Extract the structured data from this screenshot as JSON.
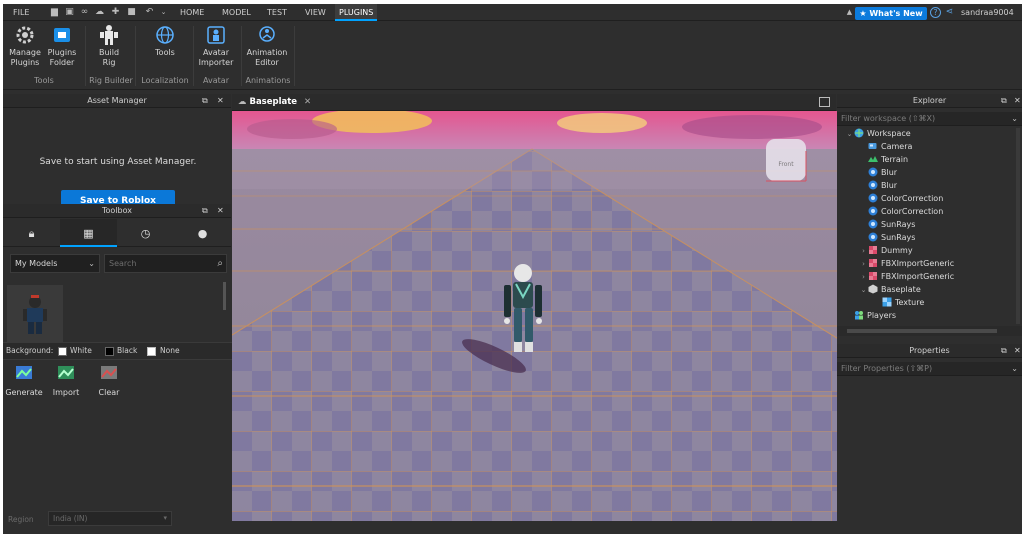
{
  "menubar": {
    "file": "FILE",
    "tabs": [
      "HOME",
      "MODEL",
      "TEST",
      "VIEW",
      "PLUGINS"
    ],
    "active_tab": "PLUGINS",
    "whats_new": "What's New",
    "username": "sandraa9004"
  },
  "ribbon": {
    "buttons": [
      {
        "label1": "Manage",
        "label2": "Plugins",
        "icon": "gear-icon"
      },
      {
        "label1": "Plugins",
        "label2": "Folder",
        "icon": "folder-plug-icon"
      },
      {
        "label1": "Build",
        "label2": "Rig",
        "icon": "rig-icon"
      },
      {
        "label1": "Tools",
        "label2": "",
        "icon": "globe-icon"
      },
      {
        "label1": "Avatar",
        "label2": "Importer",
        "icon": "avatar-importer-icon"
      },
      {
        "label1": "Animation",
        "label2": "Editor",
        "icon": "animation-editor-icon"
      }
    ],
    "groups": [
      "Tools",
      "Rig Builder",
      "Localization",
      "Avatar",
      "Animations"
    ]
  },
  "asset_manager": {
    "title": "Asset Manager",
    "message": "Save to start using Asset Manager.",
    "save_button": "Save to Roblox"
  },
  "toolbox": {
    "title": "Toolbox",
    "tabs": [
      "lock-icon",
      "grid-icon",
      "clock-icon",
      "lightbulb-icon"
    ],
    "category": "My Models",
    "search_placeholder": "Search",
    "background_label": "Background:",
    "bg_options": [
      "White",
      "Black",
      "None"
    ],
    "tools": [
      "Generate",
      "Import",
      "Clear"
    ],
    "region_label": "Region",
    "region_value": "India (IN)"
  },
  "viewport": {
    "tab_label": "Baseplate",
    "view_cube_label": "Front"
  },
  "explorer": {
    "title": "Explorer",
    "filter_placeholder": "Filter workspace (⇧⌘X)",
    "items": [
      {
        "label": "Workspace",
        "depth": 0,
        "expand": "open",
        "icon": "workspace"
      },
      {
        "label": "Camera",
        "depth": 1,
        "expand": "",
        "icon": "camera"
      },
      {
        "label": "Terrain",
        "depth": 1,
        "expand": "",
        "icon": "terrain"
      },
      {
        "label": "Blur",
        "depth": 1,
        "expand": "",
        "icon": "effect"
      },
      {
        "label": "Blur",
        "depth": 1,
        "expand": "",
        "icon": "effect"
      },
      {
        "label": "ColorCorrection",
        "depth": 1,
        "expand": "",
        "icon": "effect"
      },
      {
        "label": "ColorCorrection",
        "depth": 1,
        "expand": "",
        "icon": "effect"
      },
      {
        "label": "SunRays",
        "depth": 1,
        "expand": "",
        "icon": "effect"
      },
      {
        "label": "SunRays",
        "depth": 1,
        "expand": "",
        "icon": "effect"
      },
      {
        "label": "Dummy",
        "depth": 1,
        "expand": "closed",
        "icon": "model"
      },
      {
        "label": "FBXImportGeneric",
        "depth": 1,
        "expand": "closed",
        "icon": "model"
      },
      {
        "label": "FBXImportGeneric",
        "depth": 1,
        "expand": "closed",
        "icon": "model"
      },
      {
        "label": "Baseplate",
        "depth": 1,
        "expand": "open",
        "icon": "part"
      },
      {
        "label": "Texture",
        "depth": 2,
        "expand": "",
        "icon": "texture"
      },
      {
        "label": "Players",
        "depth": 0,
        "expand": "",
        "icon": "players"
      }
    ]
  },
  "properties": {
    "title": "Properties",
    "filter_placeholder": "Filter Properties (⇧⌘P)"
  },
  "colors": {
    "accent": "#00a2ff",
    "panel": "#2e2e2e",
    "button_blue": "#0b78d8"
  }
}
